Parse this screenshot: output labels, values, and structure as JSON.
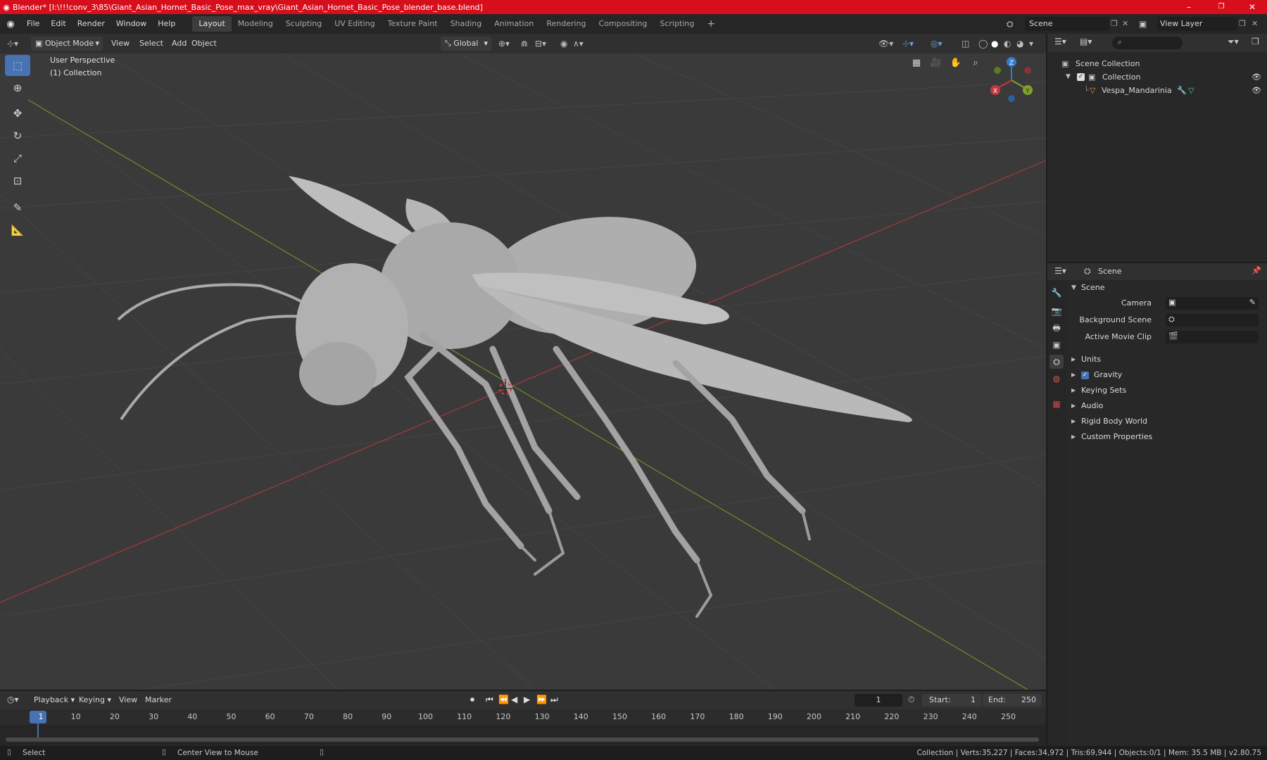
{
  "window": {
    "title": "Blender* [I:\\!!!conv_3\\85\\Giant_Asian_Hornet_Basic_Pose_max_vray\\Giant_Asian_Hornet_Basic_Pose_blender_base.blend]",
    "minimize": "–",
    "maximize": "❐",
    "close": "✕"
  },
  "menu": [
    "File",
    "Edit",
    "Render",
    "Window",
    "Help"
  ],
  "workspaces": [
    "Layout",
    "Modeling",
    "Sculpting",
    "UV Editing",
    "Texture Paint",
    "Shading",
    "Animation",
    "Rendering",
    "Compositing",
    "Scripting"
  ],
  "workspace_add": "+",
  "scene_selector": {
    "label": "Scene"
  },
  "view_layer": {
    "label": "View Layer"
  },
  "viewport_header": {
    "mode": "Object Mode",
    "view": "View",
    "select": "Select",
    "add": "Add",
    "object": "Object",
    "transform_orientation": "Global"
  },
  "viewport": {
    "perspective": "User Perspective",
    "collection": "(1) Collection",
    "gizmo": {
      "x": "X",
      "y": "Y",
      "z": "Z"
    }
  },
  "outliner": {
    "root": "Scene Collection",
    "collection": "Collection",
    "object": "Vespa_Mandarinia"
  },
  "properties": {
    "context": "Scene",
    "panel_title": "Scene",
    "fields": [
      {
        "label": "Camera"
      },
      {
        "label": "Background Scene"
      },
      {
        "label": "Active Movie Clip"
      }
    ],
    "sections": [
      "Units",
      "Gravity",
      "Keying Sets",
      "Audio",
      "Rigid Body World",
      "Custom Properties"
    ]
  },
  "timeline": {
    "playback": "Playback",
    "keying": "Keying",
    "view": "View",
    "marker": "Marker",
    "current_frame": "1",
    "start_label": "Start:",
    "start": "1",
    "end_label": "End:",
    "end": "250",
    "ruler": [
      "1",
      "10",
      "20",
      "30",
      "40",
      "50",
      "60",
      "70",
      "80",
      "90",
      "100",
      "110",
      "120",
      "130",
      "140",
      "150",
      "160",
      "170",
      "180",
      "190",
      "200",
      "210",
      "220",
      "230",
      "240",
      "250"
    ]
  },
  "status": {
    "left": "Select",
    "middle": "Center View to Mouse",
    "right": "Collection | Verts:35,227 | Faces:34,972 | Tris:69,944 | Objects:0/1 | Mem: 35.5 MB | v2.80.75"
  },
  "colors": {
    "title_bar": "#d70f1c",
    "accent": "#4772b3",
    "viewport_bg": "#3a3a3a",
    "axis_x": "#c2393f",
    "axis_y": "#7fa32a",
    "axis_z": "#2f7ccf",
    "model": "#b4b4b4"
  }
}
